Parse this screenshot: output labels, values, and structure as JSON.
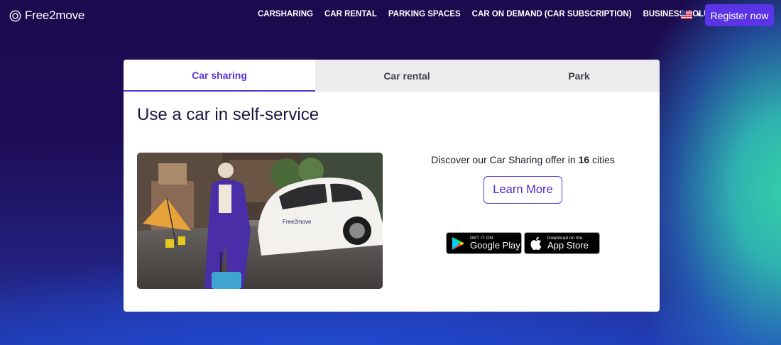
{
  "header": {
    "logo_text": "Free2move",
    "nav": [
      {
        "label": "CARSHARING"
      },
      {
        "label": "CAR RENTAL"
      },
      {
        "label": "PARKING SPACES"
      },
      {
        "label": "CAR ON DEMAND (CAR SUBSCRIPTION)"
      },
      {
        "label": "BUSINESS SOLUTIONS"
      }
    ],
    "register_label": "Register now"
  },
  "tabs": [
    {
      "label": "Car sharing",
      "active": true
    },
    {
      "label": "Car rental",
      "active": false
    },
    {
      "label": "Park",
      "active": false
    }
  ],
  "headline": {
    "prefix": "Use a ",
    "emphasis": "car in self-service"
  },
  "offer": {
    "text_before": "Discover our Car Sharing offer in ",
    "count": "16",
    "text_after": " cities",
    "learn_more_label": "Learn More"
  },
  "stores": {
    "google_small": "GET IT ON",
    "google_big": "Google Play",
    "apple_small": "Download on the",
    "apple_big": "App Store"
  },
  "photo": {
    "car_brand_text": "Free2move"
  },
  "colors": {
    "accent": "#5b35d9",
    "register": "#5a34e6",
    "background": "#1c0a4e"
  }
}
